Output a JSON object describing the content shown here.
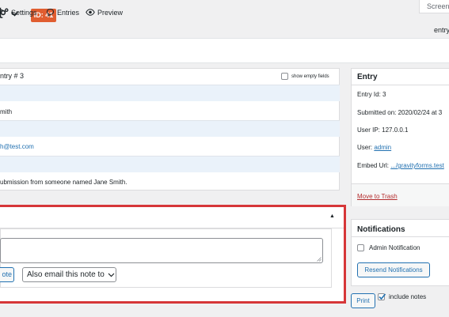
{
  "header": {
    "title_fragment": "t",
    "id_badge": "ID: 41",
    "screen_options": "Screen",
    "entry_label": "entry"
  },
  "toolbar": {
    "items": [
      {
        "label": "Settings",
        "icon": "gears-icon"
      },
      {
        "label": "Entries",
        "icon": "comment-icon"
      },
      {
        "label": "Preview",
        "icon": "eye-icon"
      }
    ]
  },
  "entry_detail": {
    "header": "ntry # 3",
    "show_empty_fields": "show empty fields",
    "values": [
      {
        "text": "mith",
        "link": false
      },
      {
        "text": "h@test.com",
        "link": true
      },
      {
        "text": "ubmission from someone named Jane Smith.",
        "link": false
      }
    ]
  },
  "notes": {
    "add_note_button": "ote",
    "email_select": "Also email this note to"
  },
  "entry_box": {
    "title": "Entry",
    "entry_id": "Entry Id: 3",
    "submitted_on": "Submitted on: 2020/02/24 at 3",
    "user_ip": "User IP: 127.0.0.1",
    "user_label": "User: ",
    "user_value": "admin",
    "embed_label": "Embed Url: ",
    "embed_value": ".../gravityforms.test",
    "move_to_trash": "Move to Trash"
  },
  "notifications": {
    "title": "Notifications",
    "admin_notification": "Admin Notification",
    "resend_button": "Resend Notifications"
  },
  "print": {
    "button": "Print",
    "include_notes": "include notes"
  },
  "colors": {
    "accent": "#2271b1",
    "badge": "#e05d30",
    "highlight_border": "#d63638",
    "trash": "#b32d2e",
    "row_label_bg": "#eaf2fa"
  }
}
